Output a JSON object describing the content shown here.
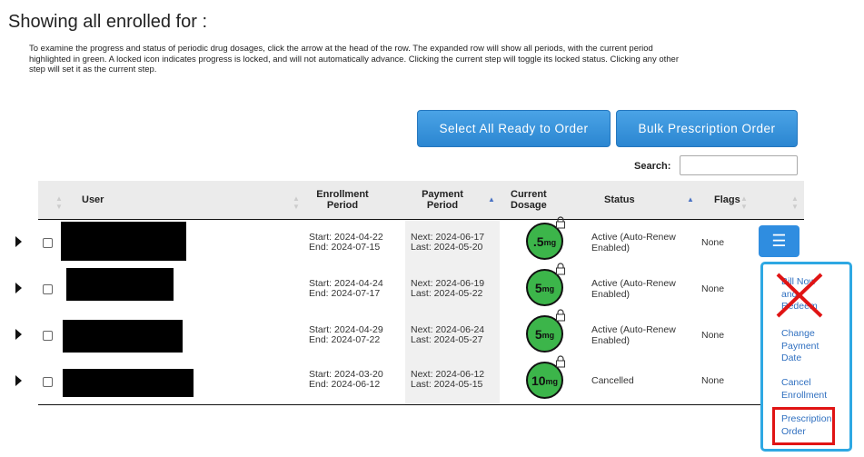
{
  "heading": "Showing all enrolled for :",
  "description": "To examine the progress and status of periodic drug dosages, click the arrow at the head of the row. The expanded row will show all periods, with the current period highlighted in green. A locked icon indicates progress is locked, and will not automatically advance. Clicking the current step will toggle its locked status. Clicking any other step will set it as the current step.",
  "buttons": {
    "select_all": "Select All Ready to Order",
    "bulk_order": "Bulk Prescription Order"
  },
  "search": {
    "label": "Search:",
    "value": ""
  },
  "columns": {
    "user": "User",
    "enrollment_period": "Enrollment Period",
    "payment_period": "Payment Period",
    "current_dosage": "Current Dosage",
    "status": "Status",
    "flags": "Flags"
  },
  "rows": [
    {
      "enroll_start": "Start: 2024-04-22",
      "enroll_end": "End: 2024-07-15",
      "pay_next": "Next: 2024-06-17",
      "pay_last": "Last: 2024-05-20",
      "dose_value": ".5",
      "dose_unit": "mg",
      "status": "Active (Auto-Renew Enabled)",
      "flags": "None"
    },
    {
      "enroll_start": "Start: 2024-04-24",
      "enroll_end": "End: 2024-07-17",
      "pay_next": "Next: 2024-06-19",
      "pay_last": "Last: 2024-05-22",
      "dose_value": "5",
      "dose_unit": "mg",
      "status": "Active (Auto-Renew Enabled)",
      "flags": "None"
    },
    {
      "enroll_start": "Start: 2024-04-29",
      "enroll_end": "End: 2024-07-22",
      "pay_next": "Next: 2024-06-24",
      "pay_last": "Last: 2024-05-27",
      "dose_value": "5",
      "dose_unit": "mg",
      "status": "Active (Auto-Renew Enabled)",
      "flags": "None"
    },
    {
      "enroll_start": "Start: 2024-03-20",
      "enroll_end": "End: 2024-06-12",
      "pay_next": "Next: 2024-06-12",
      "pay_last": "Last: 2024-05-15",
      "dose_value": "10",
      "dose_unit": "mg",
      "status": "Cancelled",
      "flags": "None"
    }
  ],
  "menu": {
    "icon": "hamburger-icon",
    "items": [
      "Bill Now and Redeem",
      "Change Payment Date",
      "Cancel Enrollment",
      "Prescription Order"
    ]
  },
  "colors": {
    "accent": "#2f8de0",
    "dose_green": "#3cb54a",
    "highlight_red": "#e01414",
    "dropdown_border": "#2ea8e3"
  }
}
